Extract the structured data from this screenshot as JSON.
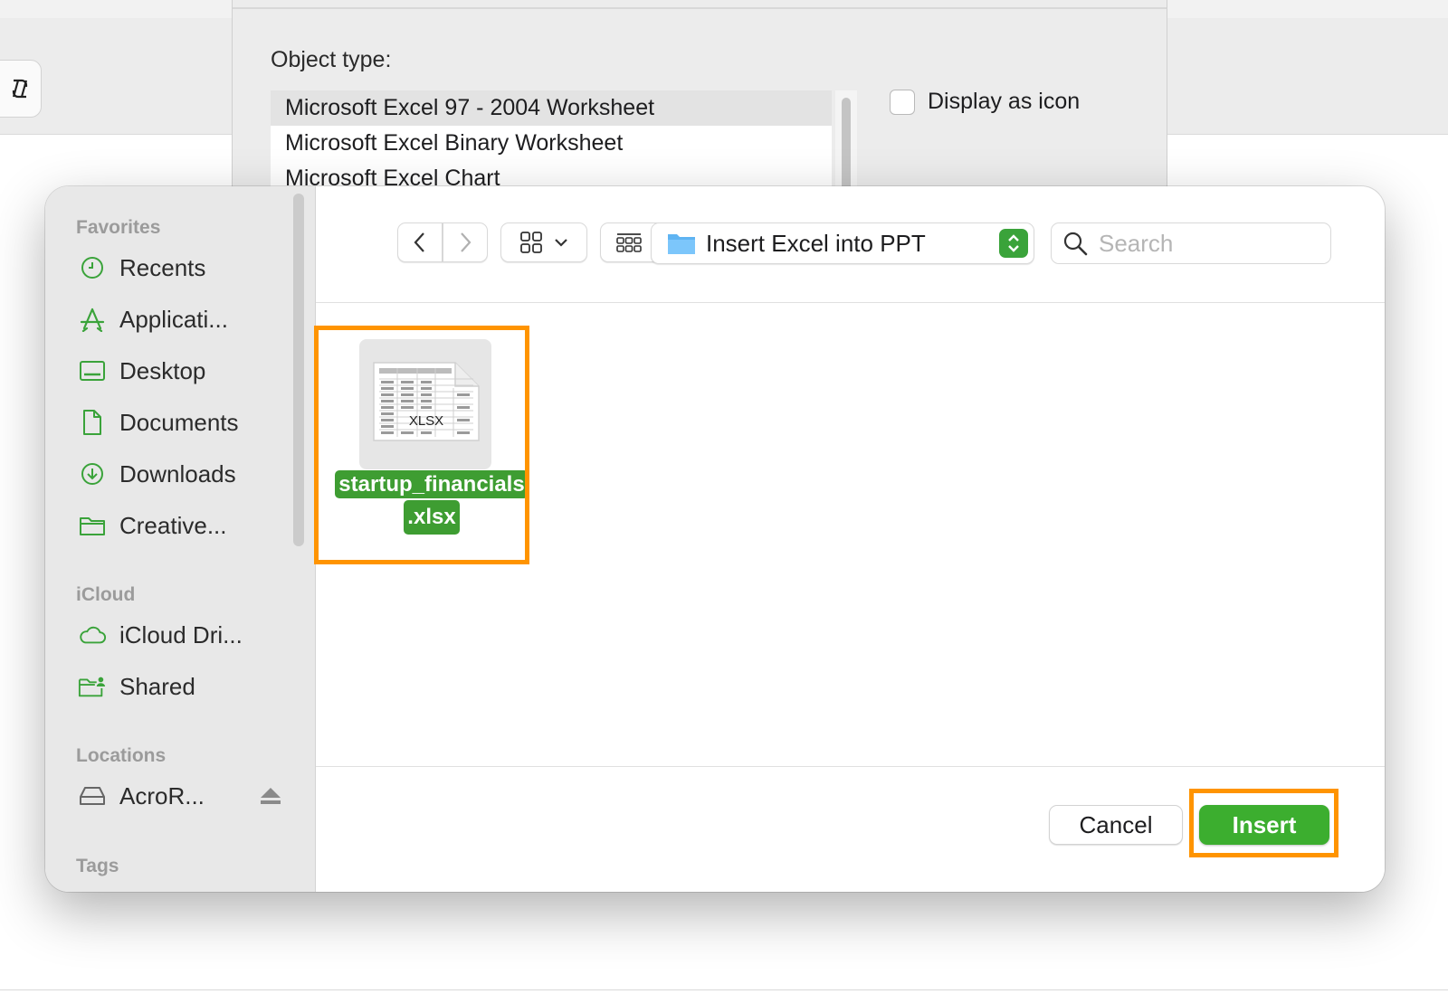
{
  "object_dialog": {
    "object_type_label": "Object type:",
    "types": [
      "Microsoft Excel 97 - 2004 Worksheet",
      "Microsoft Excel Binary Worksheet",
      "Microsoft Excel Chart"
    ],
    "selected_index": 0,
    "display_as_icon_label": "Display as icon",
    "display_as_icon_checked": false
  },
  "sidebar": {
    "favorites_label": "Favorites",
    "favorites": [
      {
        "label": "Recents",
        "icon": "clock-icon"
      },
      {
        "label": "Applicati...",
        "icon": "applications-icon"
      },
      {
        "label": "Desktop",
        "icon": "desktop-icon"
      },
      {
        "label": "Documents",
        "icon": "document-icon"
      },
      {
        "label": "Downloads",
        "icon": "download-icon"
      },
      {
        "label": "Creative...",
        "icon": "folder-icon"
      }
    ],
    "icloud_label": "iCloud",
    "icloud": [
      {
        "label": "iCloud Dri...",
        "icon": "cloud-icon"
      },
      {
        "label": "Shared",
        "icon": "shared-folder-icon"
      }
    ],
    "locations_label": "Locations",
    "locations": [
      {
        "label": "AcroR...",
        "icon": "drive-icon"
      }
    ],
    "tags_label": "Tags"
  },
  "toolbar": {
    "location": "Insert Excel into PPT",
    "search_placeholder": "Search"
  },
  "file": {
    "name_line1": "startup_financials",
    "name_line2": ".xlsx",
    "thumb_label": "XLSX"
  },
  "footer": {
    "cancel_label": "Cancel",
    "insert_label": "Insert"
  },
  "colors": {
    "accent": "#3cae2f",
    "highlight": "#ff9400",
    "sidebar_icon": "#3aa33a"
  }
}
